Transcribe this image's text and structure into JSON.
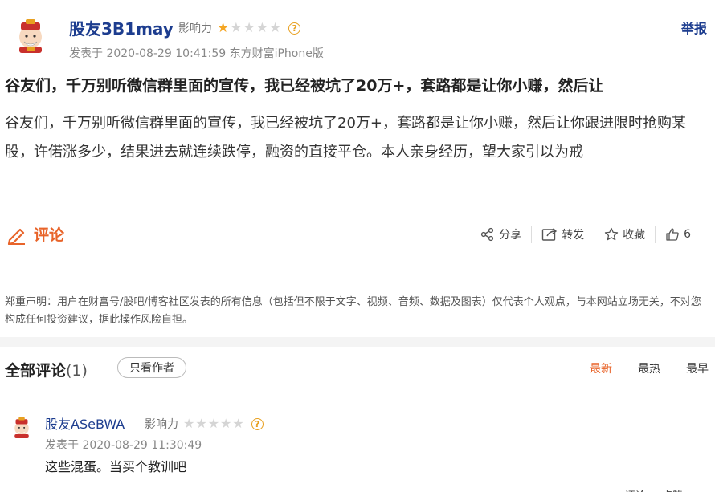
{
  "post": {
    "author": "股友3B1may",
    "influence_label": "影响力",
    "influence_stars": 1,
    "max_stars": 5,
    "report_label": "举报",
    "meta": "发表于 2020-08-29 10:41:59 东方财富iPhone版",
    "title": "谷友们，千万别听微信群里面的宣传，我已经被坑了20万+，套路都是让你小赚，然后让",
    "body": "谷友们，千万别听微信群里面的宣传，我已经被坑了20万+，套路都是让你小赚，然后让你跟进限时抢购某股，许偌涨多少，结果进去就连续跌停，融资的直接平仓。本人亲身经历，望大家引以为戒"
  },
  "actions": {
    "comment_label": "评论",
    "share_label": "分享",
    "forward_label": "转发",
    "collect_label": "收藏",
    "like_count": "6"
  },
  "disclaimer": "郑重声明：用户在财富号/股吧/博客社区发表的所有信息（包括但不限于文字、视频、音频、数据及图表）仅代表个人观点，与本网站立场无关，不对您构成任何投资建议，据此操作风险自担。",
  "comments_section": {
    "title": "全部评论",
    "count": "(1)",
    "author_only_label": "只看作者",
    "sort_tabs": [
      "最新",
      "最热",
      "最早"
    ],
    "active_sort": "最新"
  },
  "comments": [
    {
      "author": "股友ASeBWA",
      "influence_label": "影响力",
      "influence_stars": 0,
      "meta": "发表于 2020-08-29 11:30:49",
      "body": "这些混蛋。当买个教训吧",
      "reply_label": "评论",
      "like_label": "点赞"
    }
  ],
  "colors": {
    "brand_blue": "#1d3d8f",
    "accent_orange": "#e8642a",
    "star_gold": "#f5a623"
  }
}
